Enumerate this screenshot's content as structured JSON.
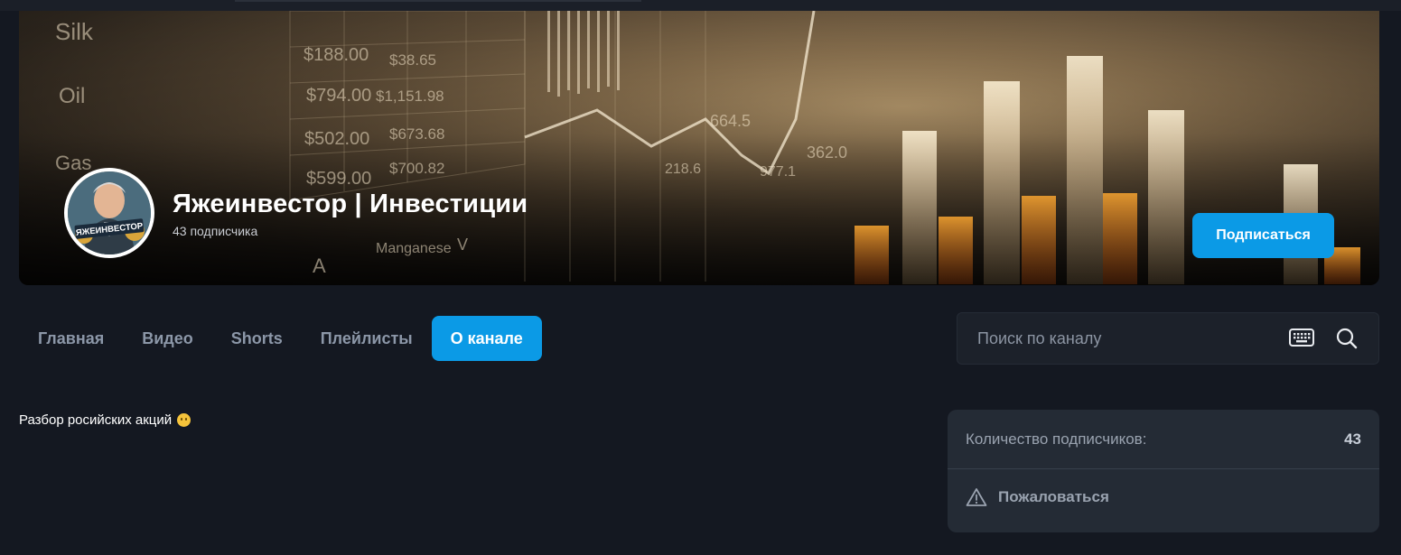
{
  "channel": {
    "name": "Яжеинвестор | Инвестиции",
    "subscribers": "43 подписчика",
    "subscribe_label": "Подписаться",
    "avatar_text": "ЯЖЕИНВЕСТОР"
  },
  "banner": {
    "labels": [
      "Silk",
      "Oil",
      "Gas",
      "$188.00",
      "$794.00",
      "$502.00",
      "$599.00",
      "$1,151.98",
      "$673.68",
      "$700.82",
      "$38.65",
      "664.5",
      "362.0",
      "218.6",
      "977.1",
      "Manganese",
      "A",
      "V"
    ]
  },
  "tabs": [
    {
      "label": "Главная"
    },
    {
      "label": "Видео"
    },
    {
      "label": "Shorts"
    },
    {
      "label": "Плейлисты"
    },
    {
      "label": "О канале",
      "active": true
    }
  ],
  "search": {
    "placeholder": "Поиск по каналу"
  },
  "about": {
    "description": "Разбор росийских акций"
  },
  "info_card": {
    "subs_label": "Количество подписчиков:",
    "subs_value": "43",
    "report_label": "Пожаловаться"
  },
  "colors": {
    "accent": "#0b9ae6",
    "background": "#141821",
    "card": "#242b35"
  },
  "icons": [
    "keyboard-icon",
    "search-icon",
    "warning-icon",
    "smile-emoji"
  ]
}
